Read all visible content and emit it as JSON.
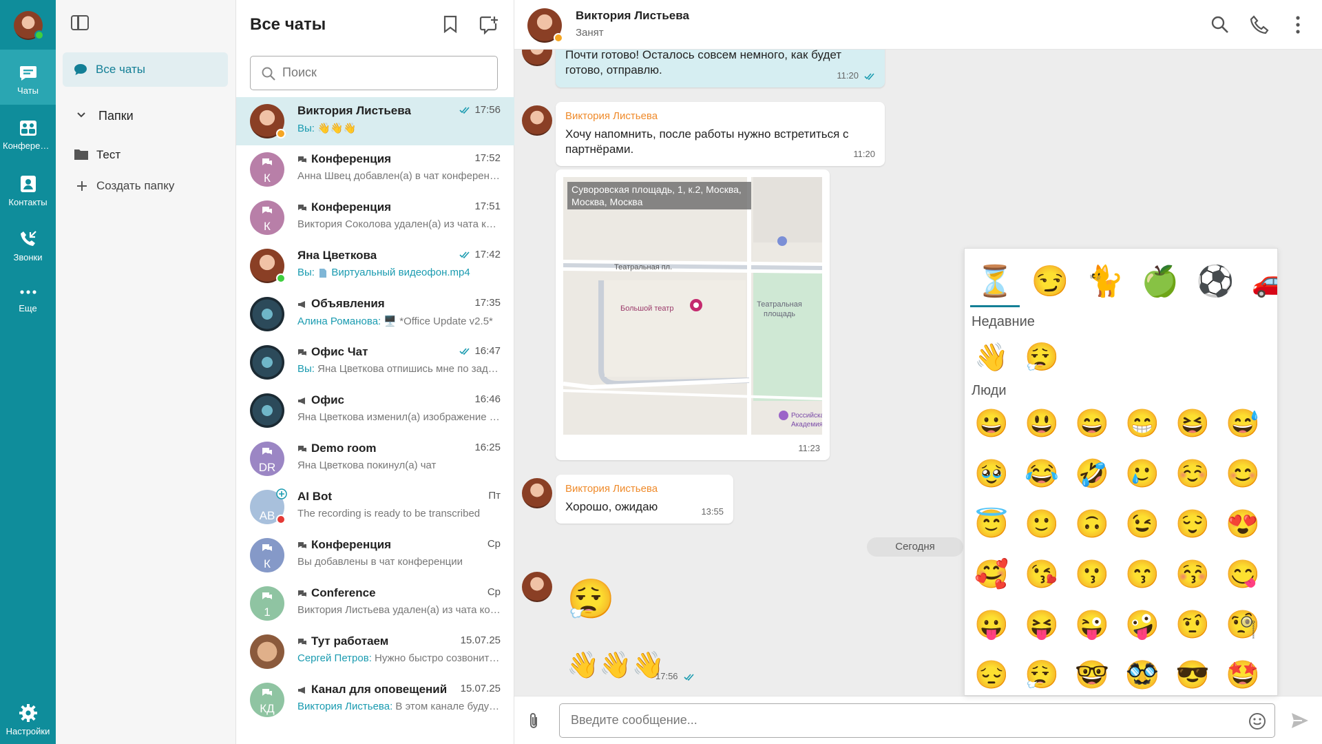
{
  "rail": {
    "items": [
      {
        "label": "Чаты",
        "icon": "chat-icon",
        "active": true
      },
      {
        "label": "Конференции",
        "icon": "conference-icon"
      },
      {
        "label": "Контакты",
        "icon": "contacts-icon"
      },
      {
        "label": "Звонки",
        "icon": "calls-icon"
      },
      {
        "label": "Еще",
        "icon": "more-horizontal-icon"
      }
    ],
    "settings_label": "Настройки"
  },
  "folders": {
    "all_chats": "Все чаты",
    "folders_header": "Папки",
    "items": [
      {
        "label": "Тест",
        "icon": "folder-icon"
      }
    ],
    "create_folder": "Создать папку"
  },
  "chatlist": {
    "title": "Все чаты",
    "search_placeholder": "Поиск",
    "chats": [
      {
        "name": "Виктория Листьева",
        "time": "17:56",
        "who": "Вы:",
        "preview": "👋👋👋",
        "read": true,
        "selected": true,
        "avatar": "photo",
        "status": "away"
      },
      {
        "name": "Конференция",
        "time": "17:52",
        "preview": "Анна Швец добавлен(а) в чат конференции",
        "group": true,
        "initials": "К",
        "color": "#b87fa8"
      },
      {
        "name": "Конференция",
        "time": "17:51",
        "preview": "Виктория Соколова удален(а) из чата конференции",
        "group": true,
        "initials": "К",
        "color": "#b87fa8"
      },
      {
        "name": "Яна Цветкова",
        "time": "17:42",
        "who": "Вы:",
        "preview": "Виртуальный видеофон.mp4",
        "file": true,
        "read": true,
        "avatar": "photo",
        "status": "online"
      },
      {
        "name": "Объявления",
        "time": "17:35",
        "who": "Алина Романова:",
        "preview": "🖥️ *Office Update v2.5*",
        "channel": true,
        "avatar": "dark"
      },
      {
        "name": "Офис Чат",
        "time": "16:47",
        "who": "Вы:",
        "preview": "Яна Цветкова отпишись мне по задаче",
        "group": true,
        "read": true,
        "avatar": "dark"
      },
      {
        "name": "Офис",
        "time": "16:46",
        "preview": "Яна Цветкова изменил(а) изображение чата",
        "channel": true,
        "avatar": "dark"
      },
      {
        "name": "Demo room",
        "time": "16:25",
        "preview": "Яна Цветкова покинул(а) чат",
        "group": true,
        "initials": "DR",
        "color": "#9b86c4"
      },
      {
        "name": "AI Bot",
        "time": "Пт",
        "preview": "The recording  is ready to be transcribed",
        "initials": "AB",
        "color": "#a8c0dc",
        "status": "busy"
      },
      {
        "name": "Конференция",
        "time": "Ср",
        "preview": "Вы добавлены в чат конференции",
        "group": true,
        "initials": "К",
        "color": "#8599c8"
      },
      {
        "name": "Conference",
        "time": "Ср",
        "preview": "Виктория Листьева удален(а) из чата конференции",
        "group": true,
        "initials": "1",
        "color": "#8fc4a2"
      },
      {
        "name": "Тут работаем",
        "time": "15.07.25",
        "who": "Сергей Петров:",
        "preview": "Нужно быстро созвониться",
        "group": true,
        "avatar": "hands"
      },
      {
        "name": "Канал для оповещений",
        "time": "15.07.25",
        "who": "Виктория Листьева:",
        "preview": "В этом канале будут оповещения",
        "channel": true,
        "initials": "КД",
        "color": "#8fc4a2"
      }
    ]
  },
  "conversation": {
    "contact_name": "Виктория Листьева",
    "contact_status": "Занят",
    "messages": {
      "m1_text": "Почти готово! Осталось совсем немного, как будет готово, отправлю.",
      "m1_time": "11:20",
      "m2_sender": "Виктория Листьева",
      "m2_text": "Хочу напомнить, после работы нужно встретиться с партнёрами.",
      "m2_time": "11:20",
      "map_address": "Суворовская площадь, 1, к.2, Москва, Москва, Москва",
      "map_label_street": "Театральная пл.",
      "map_label_theatre": "Большой театр",
      "map_label_square": "Театральная площадь",
      "map_label_corner": "Российская Академия",
      "map_time": "11:23",
      "m4_sender": "Виктория Листьева",
      "m4_text": "Хорошо, ожидаю",
      "m4_time": "13:55",
      "date_separator": "Сегодня",
      "m5_emoji": "😮‍💨",
      "m6_emoji": "👋👋👋",
      "m6_time": "17:56"
    },
    "composer_placeholder": "Введите сообщение..."
  },
  "emoji_picker": {
    "tabs": [
      "⏳",
      "😏",
      "🐈",
      "🍏",
      "⚽",
      "🚗"
    ],
    "recent_label": "Недавние",
    "recent": [
      "👋",
      "😮‍💨"
    ],
    "people_label": "Люди",
    "people": [
      "😀",
      "😃",
      "😄",
      "😁",
      "😆",
      "😅",
      "🥹",
      "😂",
      "🤣",
      "🥲",
      "☺️",
      "😊",
      "😇",
      "🙂",
      "🙃",
      "😉",
      "😌",
      "😍",
      "🥰",
      "😘",
      "😗",
      "😙",
      "😚",
      "😋",
      "😛",
      "😝",
      "😜",
      "🤪",
      "🤨",
      "🧐",
      "😔",
      "😮‍💨",
      "🤓",
      "🥸",
      "😎",
      "🤩"
    ]
  },
  "colors": {
    "rail": "#0f8d9b",
    "accent": "#137f96",
    "sender": "#ef8a2a",
    "mine_bubble": "#d6eef2",
    "read_tick": "#1a9bb0"
  }
}
